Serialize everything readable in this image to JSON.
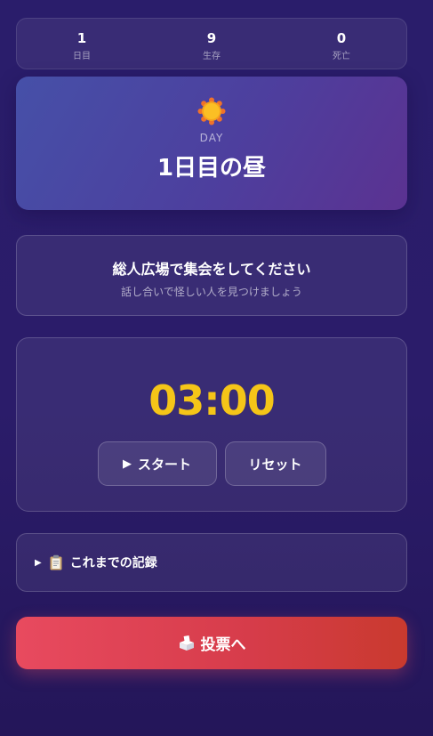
{
  "stats": [
    {
      "value": "1",
      "label": "日目"
    },
    {
      "value": "9",
      "label": "生存"
    },
    {
      "value": "0",
      "label": "死亡"
    }
  ],
  "phase": {
    "icon": "sun-icon",
    "subtitle": "DAY",
    "title": "1日目の昼"
  },
  "info": {
    "title": "総人広場で集会をしてください",
    "subtitle": "話し合いで怪しい人を見つけましょう"
  },
  "timer": {
    "value": "03:00",
    "start_label": "スタート",
    "reset_label": "リセット"
  },
  "history": {
    "label": "これまでの記録"
  },
  "vote": {
    "label": "投票へ"
  },
  "colors": {
    "timer": "#f5c518",
    "vote_start": "#e84a5f",
    "vote_end": "#c93a2e",
    "phase_card": "#4d3f9e"
  }
}
